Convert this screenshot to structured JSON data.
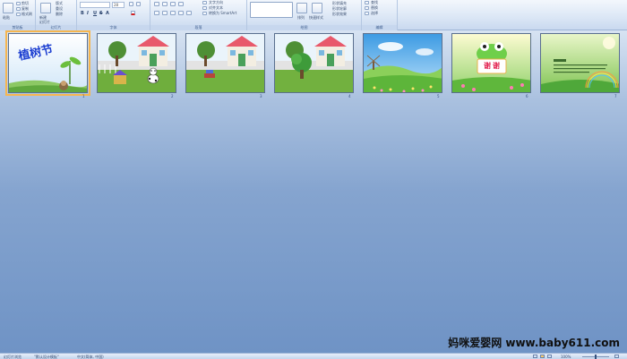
{
  "ribbon": {
    "groups": [
      {
        "label": "剪贴板"
      },
      {
        "label": "幻灯片"
      },
      {
        "label": "字体"
      },
      {
        "label": "段落"
      },
      {
        "label": "绘图"
      },
      {
        "label": "编辑"
      }
    ],
    "clipboard": {
      "paste": "粘贴",
      "cut": "剪切",
      "copy": "复制",
      "format_painter": "格式刷"
    },
    "slides": {
      "new_slide": "新建\n幻灯片",
      "layout": "版式",
      "reset": "重设",
      "delete": "删除"
    },
    "font": {
      "font_name": "",
      "font_size": "28",
      "bold": "B",
      "italic": "I",
      "underline": "U",
      "strike": "S",
      "shadow": "A"
    },
    "paragraph": {
      "text_direction": "文字方向",
      "align_text": "对齐文本",
      "convert_smartart": "转换为 SmartArt"
    },
    "drawing": {
      "arrange": "排列",
      "quick_styles": "快速样式",
      "shape_fill": "形状填充",
      "shape_outline": "形状轮廓",
      "shape_effects": "形状效果"
    },
    "editing": {
      "find": "查找",
      "replace": "替换",
      "select": "选择"
    }
  },
  "slides": [
    {
      "number": "1",
      "title": "植树节",
      "selected": true
    },
    {
      "number": "2",
      "selected": false
    },
    {
      "number": "3",
      "selected": false
    },
    {
      "number": "4",
      "selected": false
    },
    {
      "number": "5",
      "selected": false
    },
    {
      "number": "6",
      "title": "谢谢",
      "selected": false
    },
    {
      "number": "7",
      "selected": false
    }
  ],
  "statusbar": {
    "view": "幻灯片浏览",
    "theme": "\"默认设计模板\"",
    "language": "中文(简体, 中国)",
    "zoom": "100%"
  },
  "watermark": "妈咪爱婴网 www.baby611.com",
  "colors": {
    "ribbon_bg": "#dde8f6",
    "workspace_top": "#d7e3f2",
    "workspace_bottom": "#6f93c5",
    "selection": "#f6b64f"
  }
}
